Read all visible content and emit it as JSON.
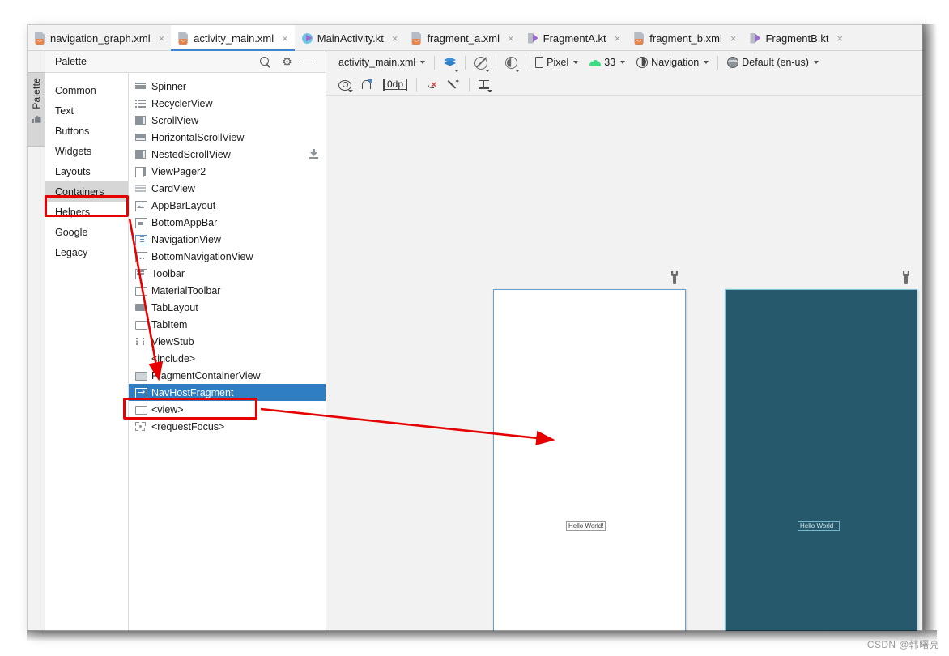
{
  "tabs": [
    {
      "label": "navigation_graph.xml",
      "icon": "xml-file-icon",
      "active": false
    },
    {
      "label": "activity_main.xml",
      "icon": "xml-file-icon",
      "active": true
    },
    {
      "label": "MainActivity.kt",
      "icon": "kotlin-activity-file-icon",
      "active": false
    },
    {
      "label": "fragment_a.xml",
      "icon": "xml-file-icon",
      "active": false
    },
    {
      "label": "FragmentA.kt",
      "icon": "kotlin-file-icon",
      "active": false
    },
    {
      "label": "fragment_b.xml",
      "icon": "xml-file-icon",
      "active": false
    },
    {
      "label": "FragmentB.kt",
      "icon": "kotlin-file-icon",
      "active": false
    }
  ],
  "close_glyph": "×",
  "left_strip": {
    "palette_tab_label": "Palette"
  },
  "palette": {
    "title": "Palette",
    "actions": [
      {
        "name": "search-icon",
        "label": ""
      },
      {
        "name": "gear-icon",
        "label": "⚙"
      },
      {
        "name": "minimize-icon",
        "label": ""
      }
    ],
    "categories": [
      {
        "label": "Common",
        "selected": false
      },
      {
        "label": "Text",
        "selected": false
      },
      {
        "label": "Buttons",
        "selected": false
      },
      {
        "label": "Widgets",
        "selected": false
      },
      {
        "label": "Layouts",
        "selected": false
      },
      {
        "label": "Containers",
        "selected": true
      },
      {
        "label": "Helpers",
        "selected": false
      },
      {
        "label": "Google",
        "selected": false
      },
      {
        "label": "Legacy",
        "selected": false
      }
    ],
    "components": [
      {
        "label": "Spinner",
        "glyph": "g-lines",
        "selected": false,
        "download": false
      },
      {
        "label": "RecyclerView",
        "glyph": "g-list",
        "selected": false,
        "download": false
      },
      {
        "label": "ScrollView",
        "glyph": "g-scroll",
        "selected": false,
        "download": false
      },
      {
        "label": "HorizontalScrollView",
        "glyph": "g-hscroll",
        "selected": false,
        "download": false
      },
      {
        "label": "NestedScrollView",
        "glyph": "g-scroll",
        "selected": false,
        "download": true
      },
      {
        "label": "ViewPager2",
        "glyph": "g-vp",
        "selected": false,
        "download": false
      },
      {
        "label": "CardView",
        "glyph": "g-card",
        "selected": false,
        "download": false
      },
      {
        "label": "AppBarLayout",
        "glyph": "g-appbar",
        "selected": false,
        "download": false
      },
      {
        "label": "BottomAppBar",
        "glyph": "g-bottombar",
        "selected": false,
        "download": false
      },
      {
        "label": "NavigationView",
        "glyph": "g-nav",
        "selected": false,
        "download": false
      },
      {
        "label": "BottomNavigationView",
        "glyph": "g-botnav",
        "selected": false,
        "download": false
      },
      {
        "label": "Toolbar",
        "glyph": "g-toolbar",
        "selected": false,
        "download": false
      },
      {
        "label": "MaterialToolbar",
        "glyph": "g-rect",
        "selected": false,
        "download": false
      },
      {
        "label": "TabLayout",
        "glyph": "g-folder",
        "selected": false,
        "download": false
      },
      {
        "label": "TabItem",
        "glyph": "g-folder2",
        "selected": false,
        "download": false
      },
      {
        "label": "ViewStub",
        "glyph": "g-stub",
        "selected": false,
        "download": false
      },
      {
        "label": "<include>",
        "glyph": "g-none",
        "selected": false,
        "download": false
      },
      {
        "label": "FragmentContainerView",
        "glyph": "g-frag",
        "selected": false,
        "download": false
      },
      {
        "label": "NavHostFragment",
        "glyph": "g-navhost",
        "selected": true,
        "download": false
      },
      {
        "label": "<view>",
        "glyph": "g-folder2",
        "selected": false,
        "download": false
      },
      {
        "label": "<requestFocus>",
        "glyph": "g-focus",
        "selected": false,
        "download": false
      }
    ]
  },
  "design_toolbar": {
    "file_name": "activity_main.xml",
    "view_modes_icon": "layers-icon",
    "blueprint_icon": "no-render-icon",
    "theme_icon": "contrast-half-icon",
    "device": "Pixel",
    "device_icon": "phone-icon",
    "api_level": "33",
    "api_icon": "android-icon",
    "theme": "Navigation",
    "theme_glyph_icon": "contrast-circle-icon",
    "locale": "Default (en-us)",
    "locale_icon": "globe-icon"
  },
  "design_toolbar2": {
    "items": [
      {
        "name": "view-options-icon",
        "label": ""
      },
      {
        "name": "autoconnect-magnet-icon",
        "label": ""
      },
      {
        "name": "default-margin-value",
        "label": "0dp"
      },
      {
        "name": "clear-constraints-icon",
        "label": ""
      },
      {
        "name": "infer-constraints-wand-icon",
        "label": ""
      },
      {
        "name": "baseline-align-icon",
        "label": ""
      }
    ],
    "margin_value": "0dp"
  },
  "canvas": {
    "previews": [
      {
        "name": "design-preview",
        "mode": "light",
        "hello_text": "Hello World!"
      },
      {
        "name": "blueprint-preview",
        "mode": "dark",
        "hello_text": "Hello World !"
      }
    ]
  },
  "annotations": {
    "highlight_category": "Containers",
    "highlight_component": "NavHostFragment"
  },
  "watermark": "CSDN @韩曙亮",
  "colors": {
    "accent_blue": "#2f7ec4",
    "annotation_red": "#e60000",
    "blueprint_bg": "#26596b",
    "panel_bg": "#f2f2f2"
  }
}
